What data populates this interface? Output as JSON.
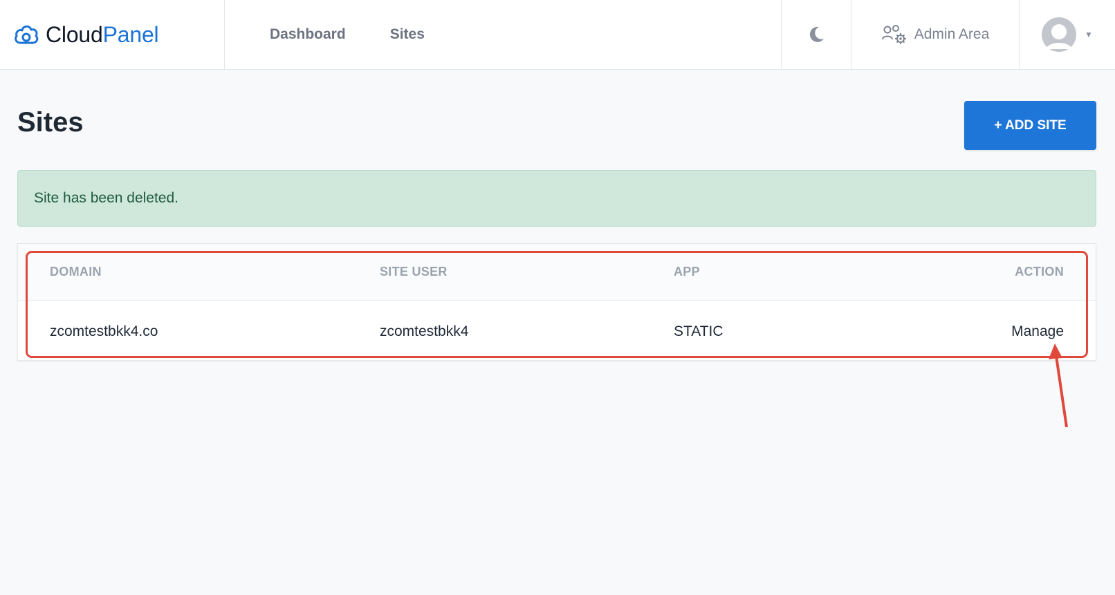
{
  "app": {
    "brand_part1": "Cloud",
    "brand_part2": "Panel",
    "accent_color": "#1a73d6"
  },
  "nav": {
    "items": [
      {
        "label": "Dashboard"
      },
      {
        "label": "Sites"
      }
    ]
  },
  "topbar": {
    "theme_icon": "moon-icon",
    "admin_label": "Admin Area",
    "admin_icon": "users-gear-icon",
    "user_icon": "avatar",
    "user_caret_icon": "caret-down-icon"
  },
  "page": {
    "title": "Sites",
    "add_button_label": "+ ADD SITE",
    "add_button_color": "#1f76d9"
  },
  "alert": {
    "message": "Site has been deleted.",
    "type": "success"
  },
  "table": {
    "headers": [
      "DOMAIN",
      "SITE USER",
      "APP",
      "ACTION"
    ],
    "rows": [
      {
        "domain": "zcomtestbkk4.co",
        "site_user": "zcomtestbkk4",
        "app": "STATIC",
        "action": "Manage"
      }
    ]
  },
  "annotation": {
    "color": "#e0483c"
  }
}
